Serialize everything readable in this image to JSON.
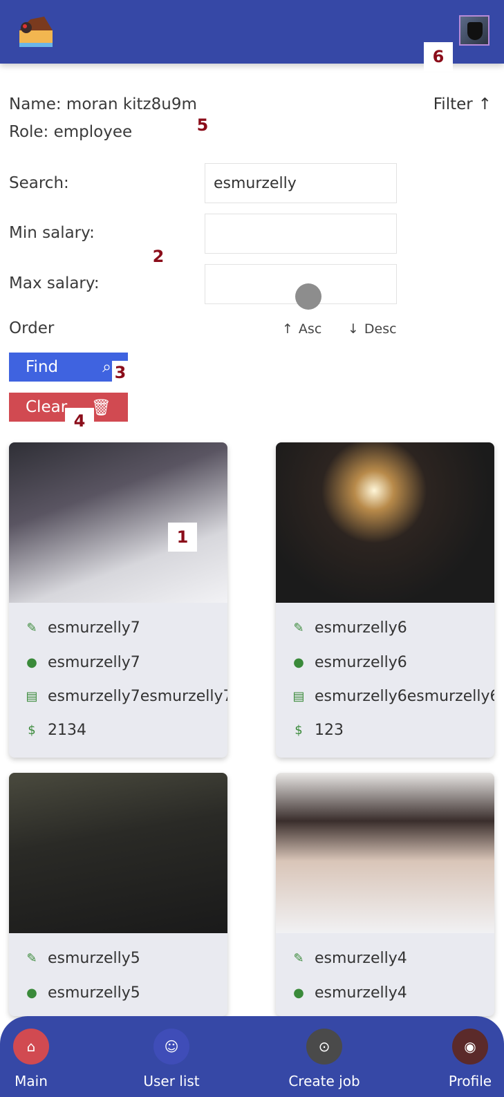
{
  "header": {
    "logo_icon": "lemur-logo-icon",
    "avatar_icon": "avatar-shield-icon"
  },
  "user": {
    "name": "Name: moran kitz8u9m",
    "role": "Role: employee"
  },
  "filter": {
    "toggle_label": "Filter",
    "toggle_icon": "arrow-up-icon"
  },
  "search": {
    "search_label": "Search:",
    "search_value": "esmurzelly",
    "min_label": "Min salary:",
    "min_value": "",
    "max_label": "Max salary:",
    "max_value": "",
    "order_label": "Order",
    "asc_label": "Asc",
    "desc_label": "Desc"
  },
  "buttons": {
    "find_label": "Find",
    "find_icon": "search-icon",
    "clear_label": "Clear",
    "clear_icon": "trash-icon"
  },
  "markers": [
    "1",
    "2",
    "3",
    "4",
    "5",
    "6"
  ],
  "jobs": [
    {
      "title": "esmurzelly7",
      "location": "esmurzelly7",
      "description": "esmurzelly7esmurzelly7esm",
      "salary": "2134"
    },
    {
      "title": "esmurzelly6",
      "location": "esmurzelly6",
      "description": "esmurzelly6esmurzelly6",
      "salary": "123"
    },
    {
      "title": "esmurzelly5",
      "location": "esmurzelly5"
    },
    {
      "title": "esmurzelly4",
      "location": "esmurzelly4"
    }
  ],
  "nav": [
    {
      "label": "Main",
      "icon": "home-icon",
      "color": "#d14a51"
    },
    {
      "label": "User list",
      "icon": "user-icon",
      "color": "#3f4db8"
    },
    {
      "label": "Create job",
      "icon": "add-circle-icon",
      "color": "#4a4a4a"
    },
    {
      "label": "Profile",
      "icon": "profile-icon",
      "color": "#5b2a2a"
    }
  ]
}
